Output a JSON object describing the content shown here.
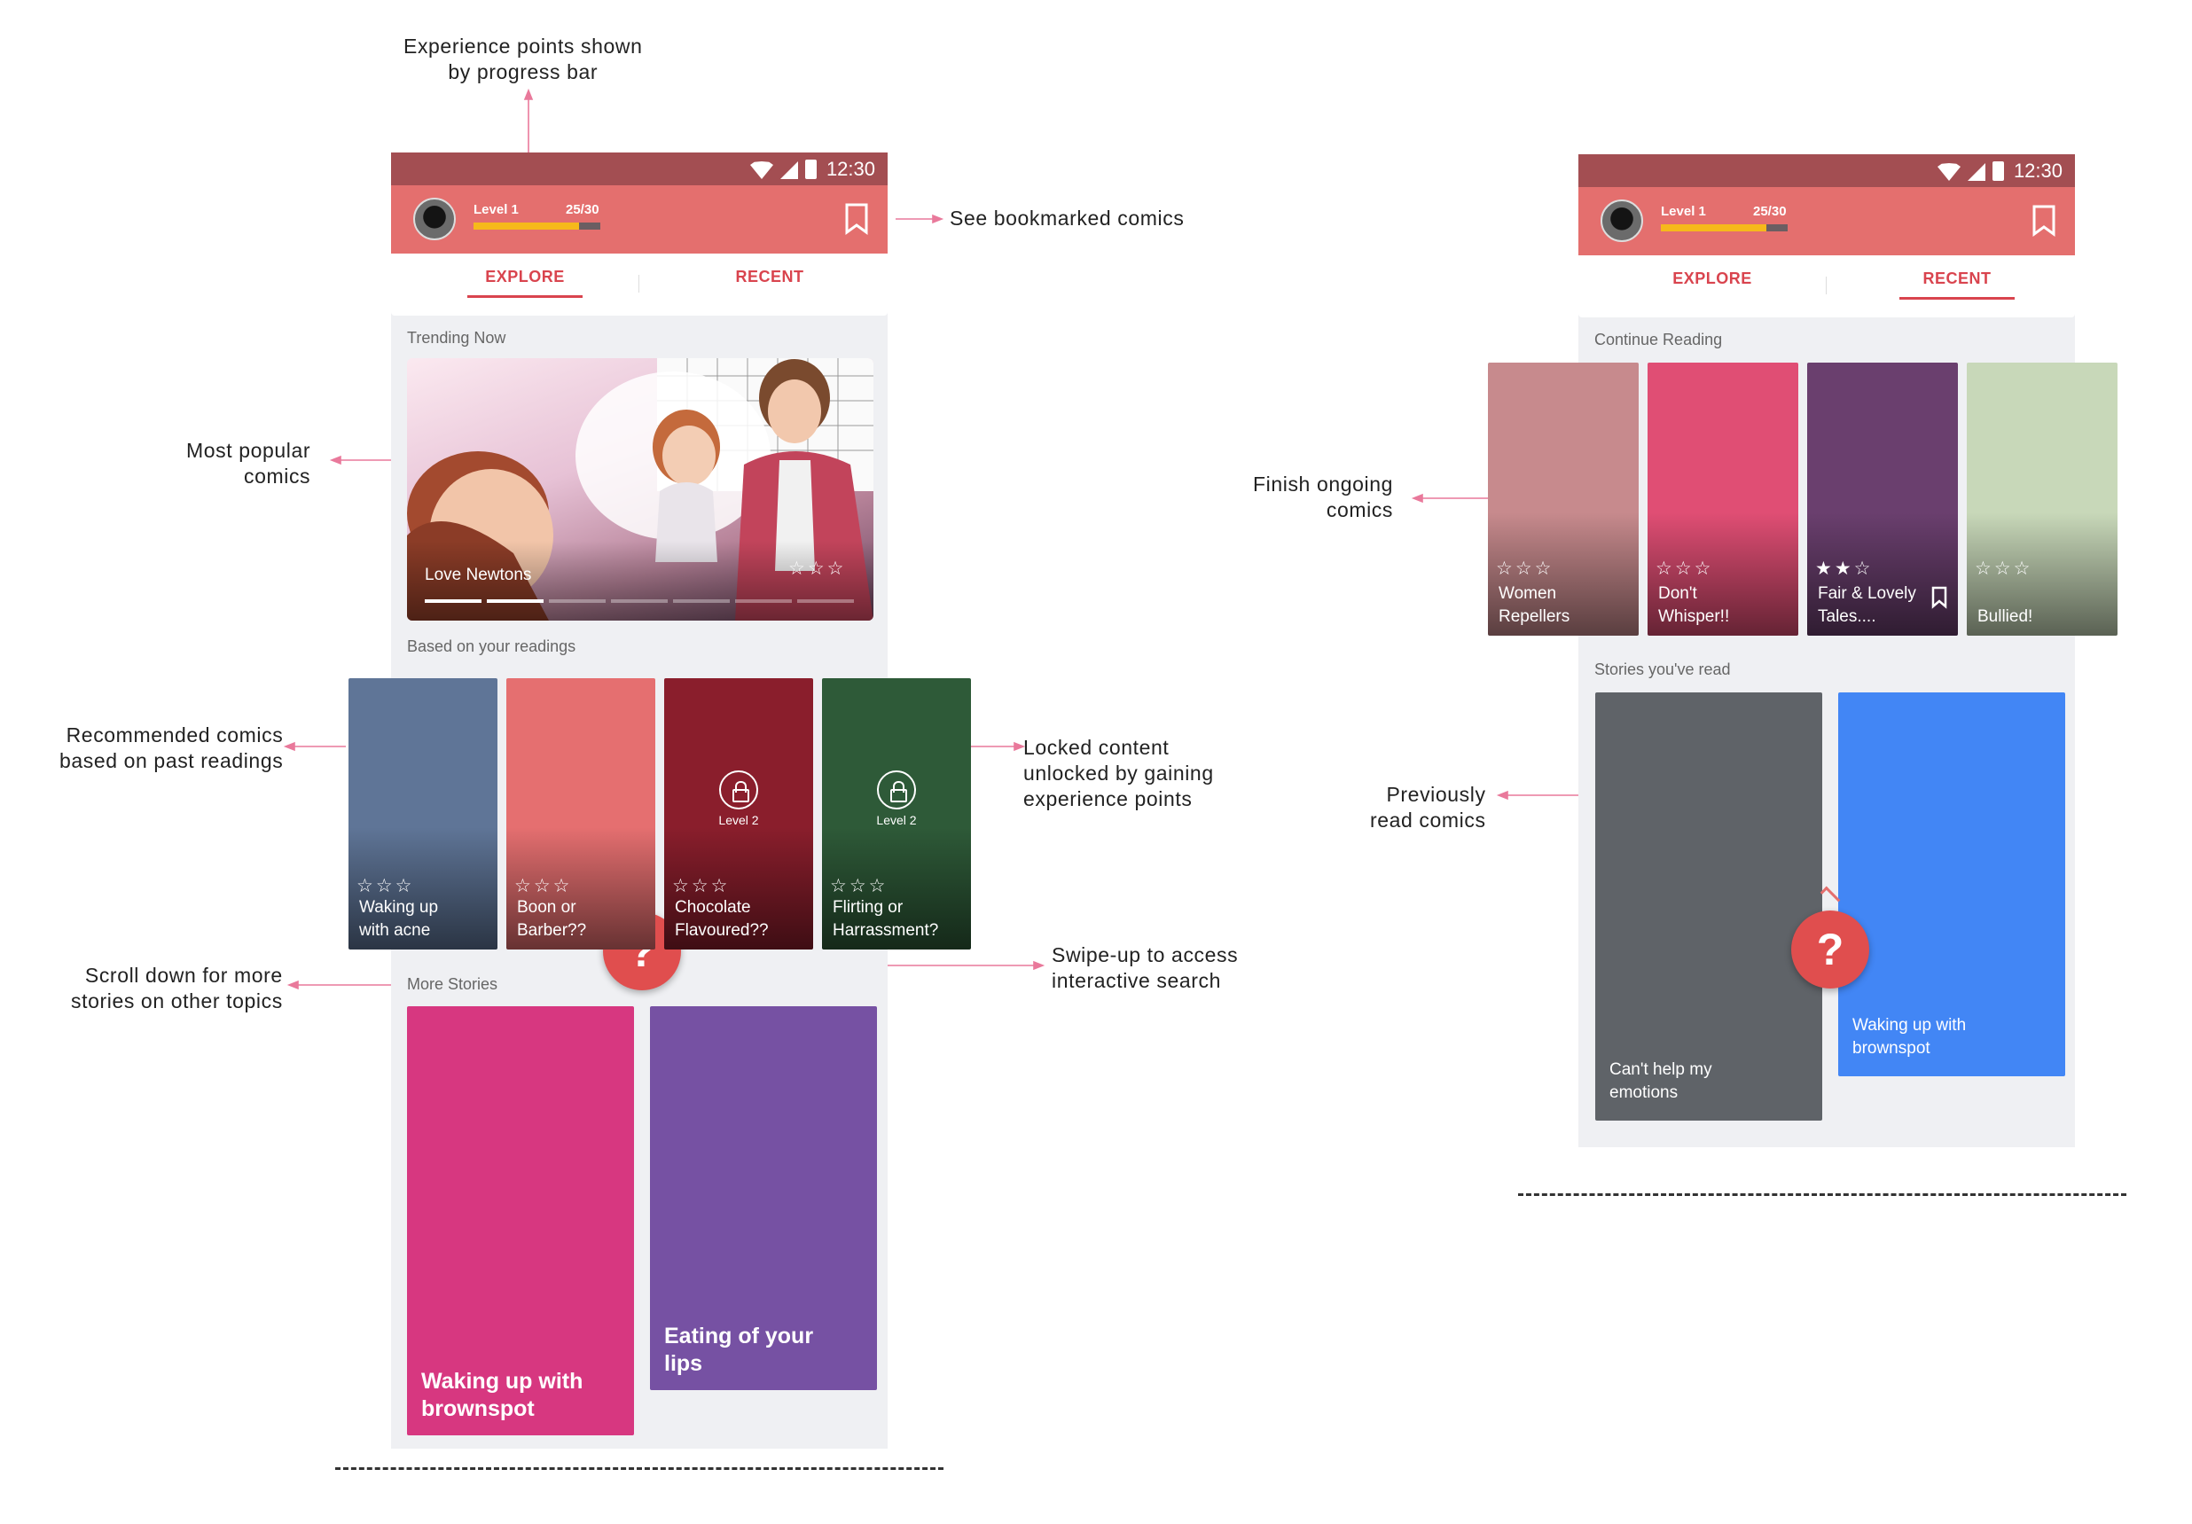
{
  "annotations": {
    "xp": [
      "Experience points shown",
      "by progress bar"
    ],
    "bookmarked": "See bookmarked comics",
    "popular": [
      "Most popular",
      "comics"
    ],
    "recommended": [
      "Recommended comics",
      "based on past readings"
    ],
    "locked": [
      "Locked content",
      "unlocked by gaining",
      "experience points"
    ],
    "scroll": [
      "Scroll down for more",
      "stories on other topics"
    ],
    "swipe": [
      "Swipe-up to access",
      "interactive search"
    ],
    "ongoing": [
      "Finish ongoing",
      "comics"
    ],
    "previous": [
      "Previously",
      "read comics"
    ]
  },
  "status": {
    "time": "12:30"
  },
  "profile": {
    "level": "Level 1",
    "xp": "25/30",
    "xp_fraction": 0.833
  },
  "tabs": {
    "explore": "EXPLORE",
    "recent": "RECENT"
  },
  "explore": {
    "trending_header": "Trending Now",
    "trending": {
      "title": "Love Newtons",
      "stars": "☆☆☆",
      "slides": 7,
      "active_slide": 2
    },
    "readings_header": "Based on your readings",
    "readings": [
      {
        "title": [
          "Waking up",
          "with acne"
        ],
        "stars": "☆☆☆",
        "locked": false,
        "color": "#5f7597"
      },
      {
        "title": [
          "Boon or",
          "Barber??"
        ],
        "stars": "☆☆☆",
        "locked": false,
        "color": "#e56f70"
      },
      {
        "title": [
          "Chocolate",
          "Flavoured??"
        ],
        "stars": "☆☆☆",
        "locked": true,
        "lock_label": "Level 2",
        "color": "#8a1e2c"
      },
      {
        "title": [
          "Flirting or",
          "Harrassment?"
        ],
        "stars": "☆☆☆",
        "locked": true,
        "lock_label": "Level 2",
        "color": "#2e5a38"
      }
    ],
    "more_header": "More Stories",
    "more": [
      {
        "title": [
          "Waking up with",
          "brownspot"
        ],
        "color": "#d73780"
      },
      {
        "title": [
          "Eating of your",
          "lips"
        ],
        "color": "#7651a3"
      }
    ],
    "fab": "?"
  },
  "recent": {
    "continue_header": "Continue Reading",
    "continue": [
      {
        "title": [
          "Women",
          "Repellers"
        ],
        "stars": "☆☆☆",
        "color": "#c78a8d"
      },
      {
        "title": [
          "Don't",
          "Whisper!!"
        ],
        "stars": "☆☆☆",
        "color": "#e04e74"
      },
      {
        "title": [
          "Fair & Lovely",
          "Tales...."
        ],
        "stars": "★★☆",
        "color": "#6a3f6e"
      },
      {
        "title": [
          "Bullied!",
          ""
        ],
        "stars": "☆☆☆",
        "color": "#c8d8b9"
      }
    ],
    "read_header": "Stories you've read",
    "read": [
      {
        "title": [
          "Can't help my",
          "emotions"
        ],
        "color": "#5f6368"
      },
      {
        "title": [
          "Waking up with",
          "brownspot"
        ],
        "color": "#4286f5"
      }
    ],
    "fab": "?"
  }
}
